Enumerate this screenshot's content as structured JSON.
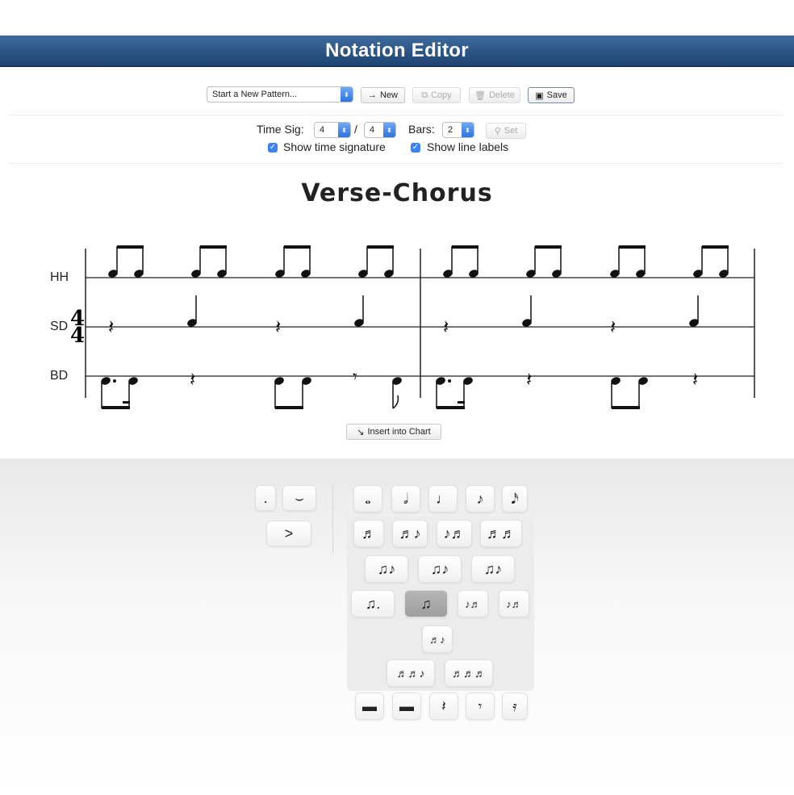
{
  "app": {
    "title": "Notation Editor"
  },
  "toolbar": {
    "pattern_select": "Start a New Pattern...",
    "new_label": "New",
    "copy_label": "Copy",
    "delete_label": "Delete",
    "save_label": "Save"
  },
  "settings": {
    "time_sig_label": "Time Sig:",
    "numerator": "4",
    "slash": "/",
    "denominator": "4",
    "bars_label": "Bars:",
    "bars": "2",
    "set_label": "Set",
    "show_time_sig_label": "Show time signature",
    "show_time_sig": true,
    "show_line_labels_label": "Show line labels",
    "show_line_labels": true
  },
  "score": {
    "title": "Verse-Chorus",
    "time_signature": "4/4",
    "lines": [
      {
        "label": "HH"
      },
      {
        "label": "SD"
      },
      {
        "label": "BD"
      }
    ],
    "insert_label": "Insert into Chart"
  },
  "palette": {
    "modifiers": [
      {
        "name": "dot",
        "glyph": "."
      },
      {
        "name": "tie",
        "glyph": "⌣"
      },
      {
        "name": "accent",
        "glyph": ">"
      }
    ],
    "durations": [
      "whole",
      "half",
      "quarter",
      "eighth",
      "sixteenth"
    ],
    "selected": "dotted-eighth-sixteenth-group",
    "rests": [
      "whole-rest",
      "half-rest",
      "quarter-rest",
      "eighth-rest",
      "sixteenth-rest"
    ]
  },
  "colors": {
    "titlebar_top": "#3d6a9e",
    "titlebar_bottom": "#1d436f",
    "checkbox": "#3b82f6"
  }
}
